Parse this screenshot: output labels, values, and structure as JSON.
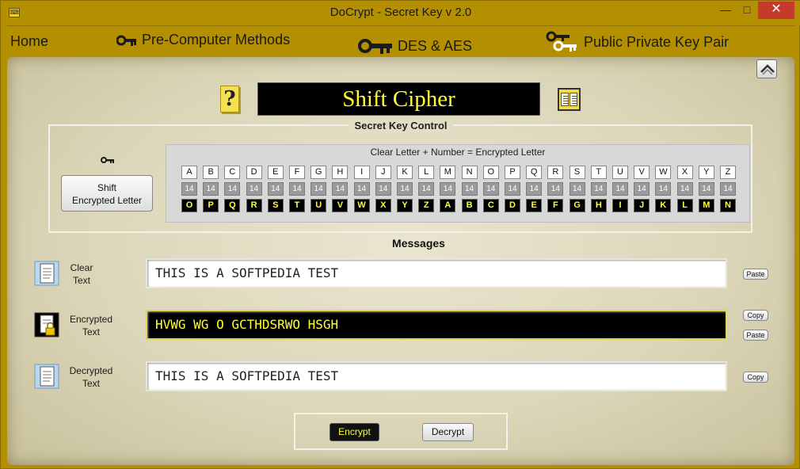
{
  "window": {
    "title": "DoCrypt - Secret Key v 2.0",
    "controls": {
      "minimize": "—",
      "maximize": "□",
      "close": "✕"
    }
  },
  "menu": {
    "home": "Home",
    "pre_computer": "Pre-Computer Methods",
    "des_aes": "DES & AES",
    "public_private": "Public Private Key Pair"
  },
  "cipher": {
    "title": "Shift Cipher",
    "help_glyph": "?"
  },
  "secret_key_control": {
    "title": "Secret Key Control",
    "shift_button": [
      "Shift",
      "Encrypted Letter"
    ],
    "formula": "Clear Letter  + Number  =  Encrypted Letter",
    "clear_letters": [
      "A",
      "B",
      "C",
      "D",
      "E",
      "F",
      "G",
      "H",
      "I",
      "J",
      "K",
      "L",
      "M",
      "N",
      "O",
      "P",
      "Q",
      "R",
      "S",
      "T",
      "U",
      "V",
      "W",
      "X",
      "Y",
      "Z"
    ],
    "shift_numbers": [
      "14",
      "14",
      "14",
      "14",
      "14",
      "14",
      "14",
      "14",
      "14",
      "14",
      "14",
      "14",
      "14",
      "14",
      "14",
      "14",
      "14",
      "14",
      "14",
      "14",
      "14",
      "14",
      "14",
      "14",
      "14",
      "14"
    ],
    "encrypted_letters": [
      "O",
      "P",
      "Q",
      "R",
      "S",
      "T",
      "U",
      "V",
      "W",
      "X",
      "Y",
      "Z",
      "A",
      "B",
      "C",
      "D",
      "E",
      "F",
      "G",
      "H",
      "I",
      "J",
      "K",
      "L",
      "M",
      "N"
    ]
  },
  "messages": {
    "title": "Messages",
    "clear": {
      "label": [
        "Clear",
        "Text"
      ],
      "value": "THIS IS A SOFTPEDIA TEST",
      "paste": "Paste"
    },
    "encrypted": {
      "label": [
        "Encrypted",
        "Text"
      ],
      "value": "HVWG WG O GCTHDSRWO HSGH",
      "copy": "Copy",
      "paste": "Paste"
    },
    "decrypted": {
      "label": [
        "Decrypted",
        "Text"
      ],
      "value": "THIS IS A SOFTPEDIA TEST",
      "copy": "Copy"
    }
  },
  "actions": {
    "encrypt": "Encrypt",
    "decrypt": "Decrypt"
  },
  "icons": {
    "app": "app-icon",
    "key": "key-icon",
    "help": "help-icon",
    "book": "book-icon",
    "collapse": "collapse-up-icon",
    "document": "document-icon",
    "locked_document": "locked-document-icon"
  },
  "colors": {
    "frame": "#b48f00",
    "encrypted_text": "#ffff33",
    "parchment": "#dcd7ba"
  }
}
